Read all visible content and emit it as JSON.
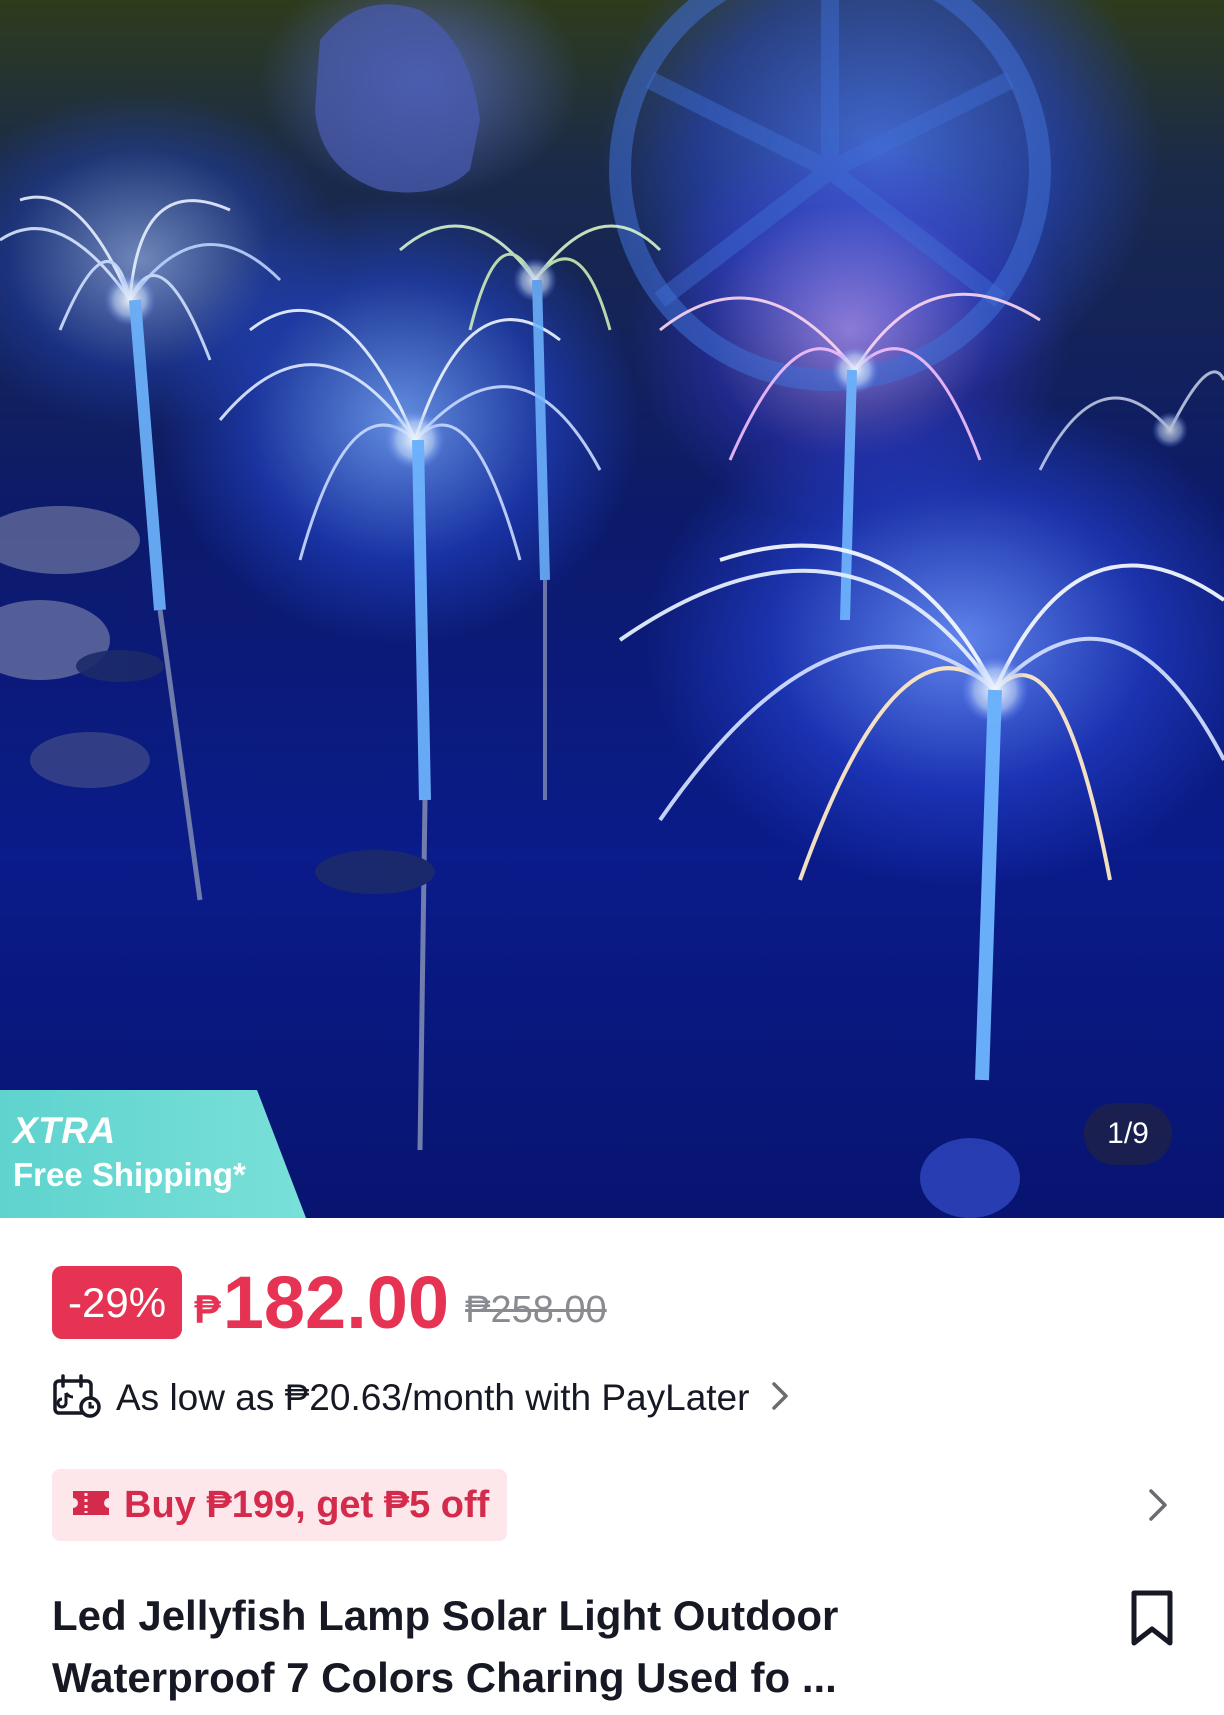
{
  "hero": {
    "badge_title": "XTRA",
    "badge_subtitle": "Free Shipping*",
    "image_counter": "1/9"
  },
  "pricing": {
    "discount": "-29%",
    "currency_symbol": "₱",
    "price": "182.00",
    "original_price": "₱258.00",
    "accent_color": "#e63353"
  },
  "paylater": {
    "text": "As low as ₱20.63/month with PayLater",
    "icon": "paylater-calendar-icon"
  },
  "promo": {
    "text": "Buy ₱199, get ₱5 off",
    "icon": "coupon-ticket-icon"
  },
  "product": {
    "title": "Led Jellyfish Lamp Solar Light Outdoor Waterproof 7 Colors Charing Used fo ...",
    "bookmark_icon": "bookmark-icon"
  },
  "colors": {
    "badge": "#5fd3ce",
    "promo_bg": "#fde7ea",
    "promo_text": "#d42a4b"
  }
}
